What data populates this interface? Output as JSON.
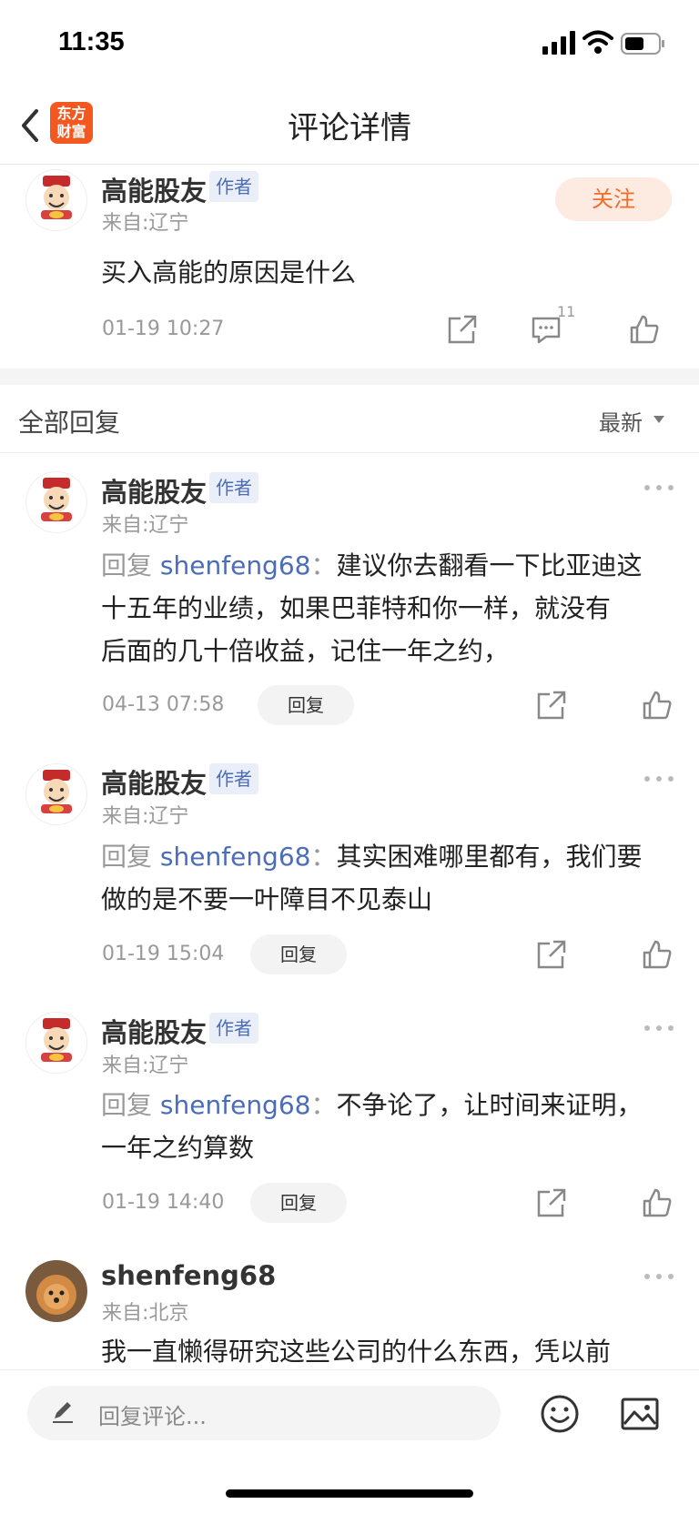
{
  "status_bar": {
    "time": "11:35"
  },
  "nav": {
    "title": "评论详情",
    "logo_text": "东方财富"
  },
  "main_comment": {
    "username": "高能股友",
    "badge": "作者",
    "location": "来自:辽宁",
    "text": "买入高能的原因是什么",
    "timestamp": "01-19 10:27",
    "follow_label": "关注",
    "reply_count": "11"
  },
  "replies_header": {
    "title": "全部回复",
    "sort_label": "最新"
  },
  "replies": [
    {
      "username": "高能股友",
      "badge": "作者",
      "location": "来自:辽宁",
      "reply_prefix": "回复",
      "reply_to": "shenfeng68",
      "colon": "：",
      "line1": "建议你去翻看一下比亚迪这",
      "line2": "十五年的业绩，如果巴菲特和你一样，就没有",
      "line3": "后面的几十倍收益，记住一年之约，",
      "timestamp": "04-13 07:58",
      "reply_button": "回复"
    },
    {
      "username": "高能股友",
      "badge": "作者",
      "location": "来自:辽宁",
      "reply_prefix": "回复",
      "reply_to": "shenfeng68",
      "colon": "：",
      "line1": "其实困难哪里都有，我们要",
      "line2": "做的是不要一叶障目不见泰山",
      "timestamp": "01-19 15:04",
      "reply_button": "回复"
    },
    {
      "username": "高能股友",
      "badge": "作者",
      "location": "来自:辽宁",
      "reply_prefix": "回复",
      "reply_to": "shenfeng68",
      "colon": "：",
      "line1": "不争论了，让时间来证明，",
      "line2": "一年之约算数",
      "timestamp": "01-19 14:40",
      "reply_button": "回复"
    },
    {
      "username": "shenfeng68",
      "location": "来自:北京",
      "line1": "我一直懒得研究这些公司的什么东西，凭以前"
    }
  ],
  "bottom_bar": {
    "input_placeholder": "回复评论..."
  },
  "colors": {
    "accent": "#f26b2a",
    "link": "#4b6cb7",
    "logo": "#f2581f"
  }
}
